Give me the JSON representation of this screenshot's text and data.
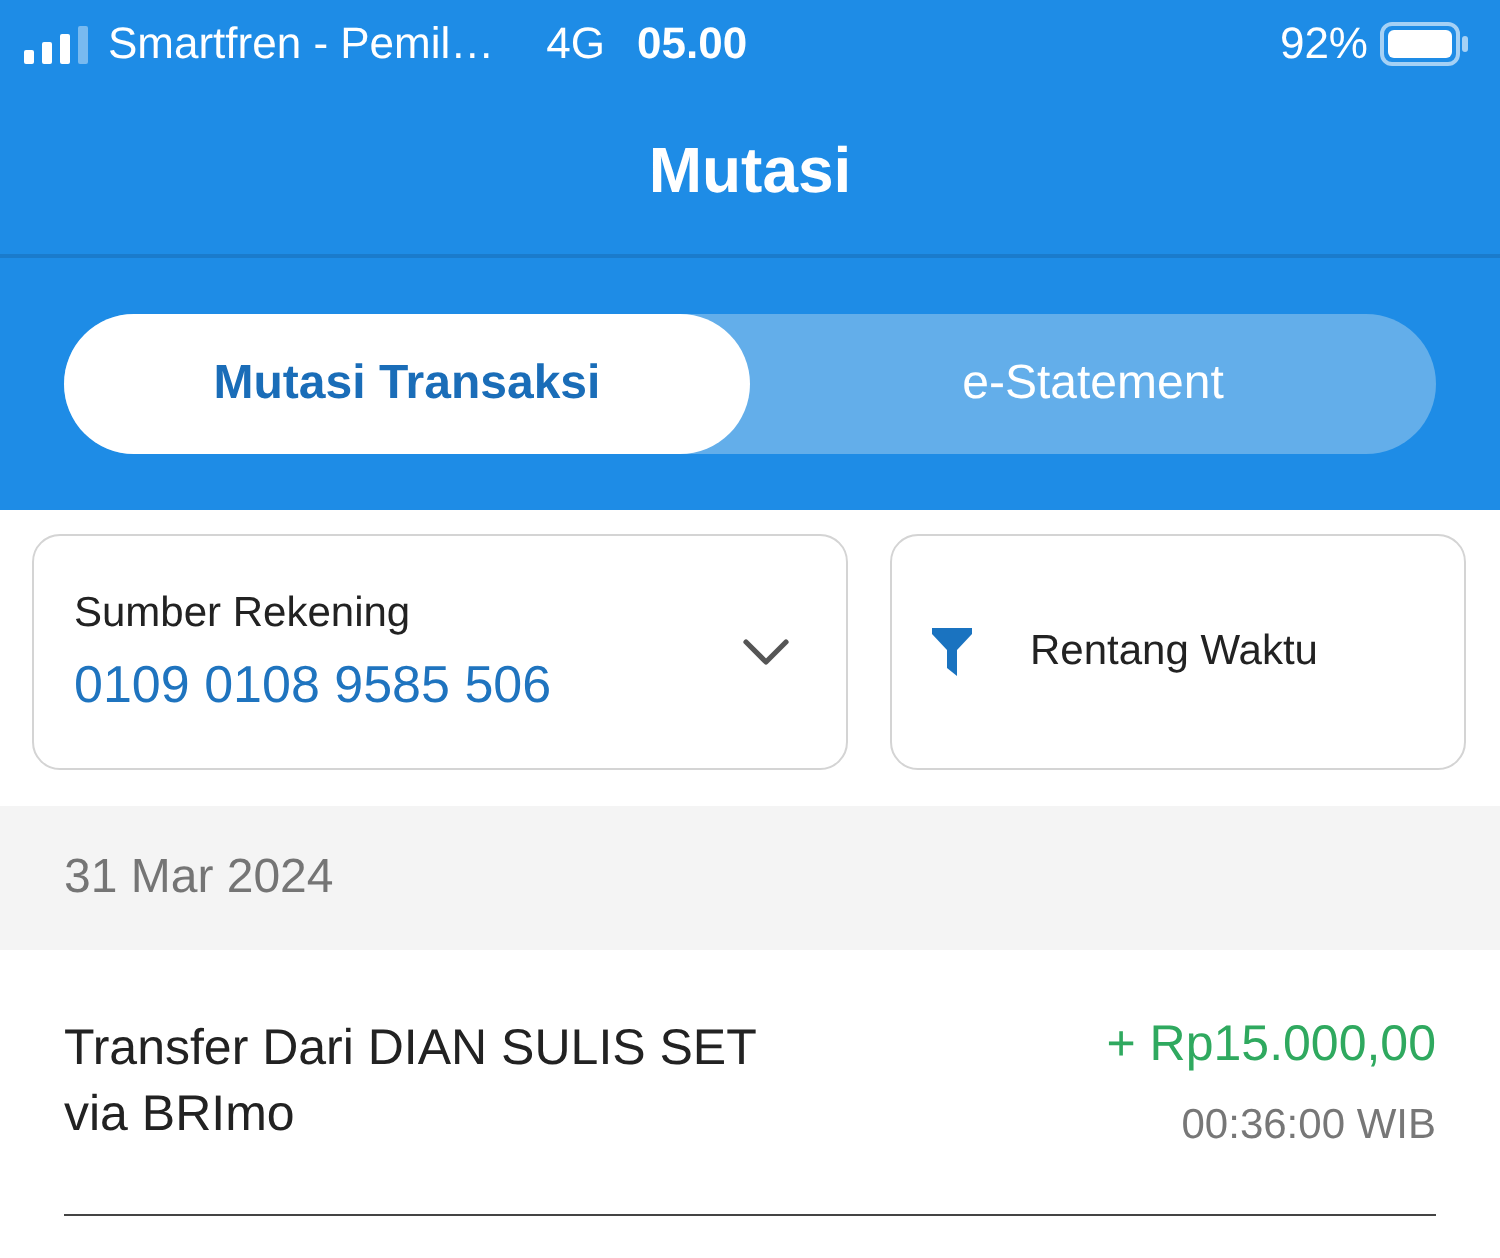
{
  "status_bar": {
    "carrier": "Smartfren - Pemil…",
    "network": "4G",
    "time": "05.00",
    "battery": "92%"
  },
  "header": {
    "title": "Mutasi"
  },
  "tabs": [
    {
      "label": "Mutasi Transaksi",
      "selected": true
    },
    {
      "label": "e-Statement",
      "selected": false
    }
  ],
  "account_selector": {
    "label": "Sumber Rekening",
    "value": "0109 0108 9585 506"
  },
  "filter_button": {
    "label": "Rentang Waktu"
  },
  "groups": [
    {
      "date": "31 Mar 2024",
      "transactions": [
        {
          "kind": "credit",
          "description": "Transfer Dari DIAN SULIS SET via BRImo",
          "amount": "+ Rp15.000,00",
          "time": "00:36:00 WIB"
        }
      ]
    }
  ]
}
